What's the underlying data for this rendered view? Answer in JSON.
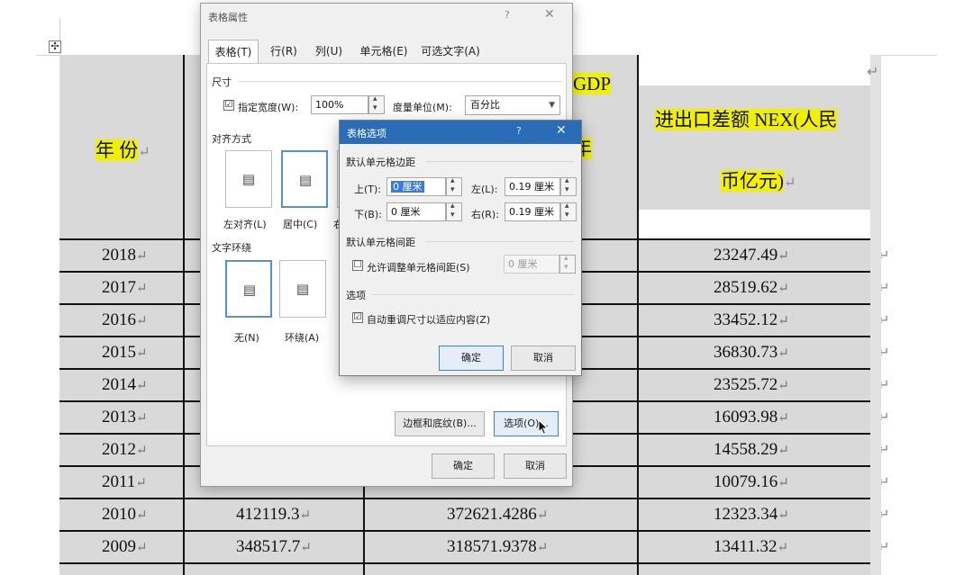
{
  "document": {
    "move_handle_glyph": "✣",
    "header": {
      "year": "年 份",
      "year_mark": "↵",
      "gdp_fragment": "GDP",
      "year_fragment": "年",
      "nex_line1": "进出口差额 NEX(人民",
      "nex_line2": "币亿元)",
      "nex_mark": "↵",
      "right_mark": "↵"
    },
    "rows": [
      {
        "year": "2018",
        "col2": "",
        "col3": "",
        "nex": "23247.49"
      },
      {
        "year": "2017",
        "col2": "",
        "col3": "",
        "nex": "28519.62"
      },
      {
        "year": "2016",
        "col2": "",
        "col3": "",
        "nex": "33452.12"
      },
      {
        "year": "2015",
        "col2": "",
        "col3": "",
        "nex": "36830.73"
      },
      {
        "year": "2014",
        "col2": "",
        "col3": "",
        "nex": "23525.72"
      },
      {
        "year": "2013",
        "col2": "",
        "col3": "",
        "nex": "16093.98"
      },
      {
        "year": "2012",
        "col2": "",
        "col3": "",
        "nex": "14558.29"
      },
      {
        "year": "2011",
        "col2": "",
        "col3": "",
        "nex": "10079.16"
      },
      {
        "year": "2010",
        "col2": "412119.3",
        "col3": "372621.4286",
        "nex": "12323.34"
      },
      {
        "year": "2009",
        "col2": "348517.7",
        "col3": "318571.9378",
        "nex": "13411.32"
      }
    ],
    "return_mark": "↵"
  },
  "table_properties": {
    "title": "表格属性",
    "help": "?",
    "close": "✕",
    "tabs": [
      "表格(T)",
      "行(R)",
      "列(U)",
      "单元格(E)",
      "可选文字(A)"
    ],
    "size_label": "尺寸",
    "preferred_width_label": "指定宽度(W):",
    "preferred_width_checked": "☑",
    "preferred_width_value": "100%",
    "measure_label": "度量单位(M):",
    "measure_value": "百分比",
    "alignment_label": "对齐方式",
    "align_left": "左对齐(L)",
    "align_center": "居中(C)",
    "align_right_partial": "右",
    "wrap_label": "文字环绕",
    "wrap_none": "无(N)",
    "wrap_around": "环绕(A)",
    "borders_button": "边框和底纹(B)...",
    "options_button": "选项(O)...",
    "ok_button": "确定",
    "cancel_button": "取消"
  },
  "table_options": {
    "title": "表格选项",
    "help": "?",
    "close": "✕",
    "margins_label": "默认单元格边距",
    "top_label": "上(T):",
    "top_value": "0 厘米",
    "bottom_label": "下(B):",
    "bottom_value": "0 厘米",
    "left_label": "左(L):",
    "left_value": "0.19 厘米",
    "right_label": "右(R):",
    "right_value": "0.19 厘米",
    "spacing_label": "默认单元格间距",
    "allow_spacing_label": "允许调整单元格间距(S)",
    "allow_spacing_checked": "☐",
    "spacing_value": "0 厘米",
    "options_label": "选项",
    "autoresize_label": "自动重调尺寸以适应内容(Z)",
    "autoresize_checked": "☑",
    "ok_button": "确定",
    "cancel_button": "取消"
  }
}
